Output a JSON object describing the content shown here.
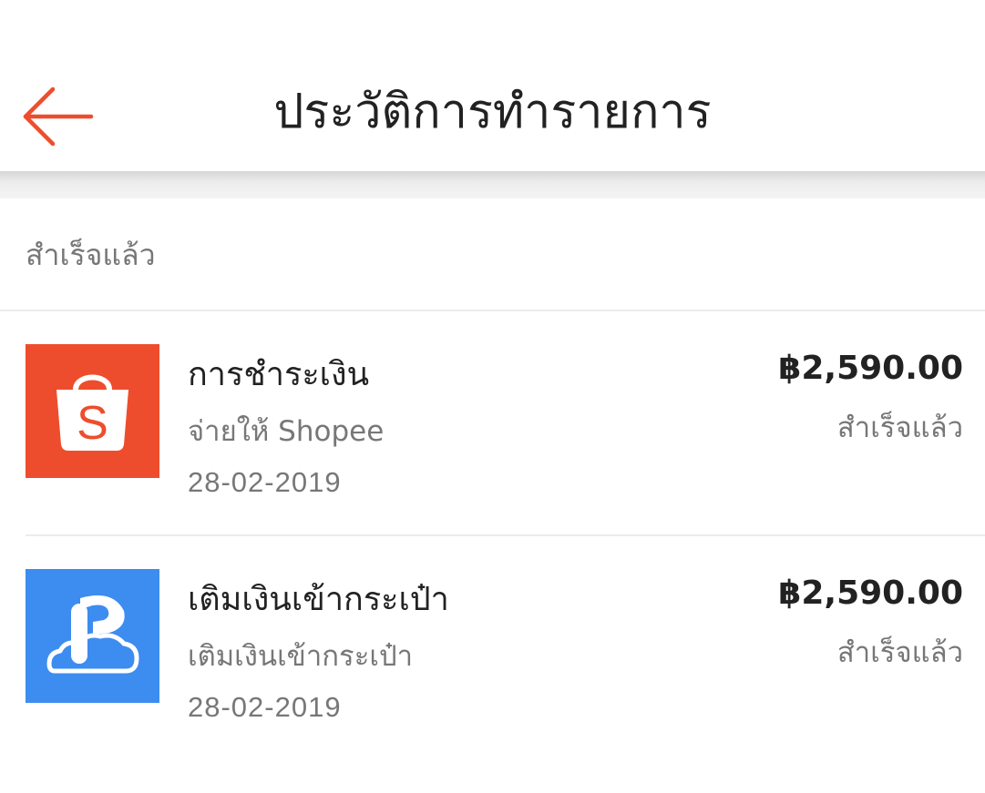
{
  "header": {
    "title": "ประวัติการทำรายการ",
    "back_icon": "arrow-left-icon",
    "accent_color": "#ee4d2d"
  },
  "section": {
    "label": "สำเร็จแล้ว"
  },
  "transactions": [
    {
      "icon": "shopee-bag-icon",
      "icon_bg": "#ee4d2d",
      "title": "การชำระเงิน",
      "subtitle": "จ่ายให้ Shopee",
      "date": "28-02-2019",
      "amount": "฿2,590.00",
      "status": "สำเร็จแล้ว"
    },
    {
      "icon": "wallet-topup-icon",
      "icon_bg": "#3d8cf0",
      "title": "เติมเงินเข้ากระเป๋า",
      "subtitle": "เติมเงินเข้ากระเป๋า",
      "date": "28-02-2019",
      "amount": "฿2,590.00",
      "status": "สำเร็จแล้ว"
    }
  ]
}
